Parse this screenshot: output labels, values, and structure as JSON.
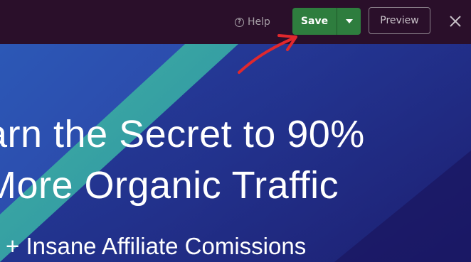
{
  "toolbar": {
    "help_label": "Help",
    "help_icon": "question-circle-icon",
    "save_label": "Save",
    "save_dropdown_icon": "caret-down-icon",
    "preview_label": "Preview",
    "close_icon": "close-icon"
  },
  "hero": {
    "line1": "arn the Secret to 90%",
    "line2": "More Organic Traffic",
    "line3": "+ Insane Affiliate Comissions"
  },
  "colors": {
    "topbar_bg": "#2a0f2a",
    "save_green": "#2e7d3e",
    "canvas_blue": "#2c58b6",
    "teal_stripe": "#3fb8a0",
    "arrow_red": "#e0282d"
  }
}
